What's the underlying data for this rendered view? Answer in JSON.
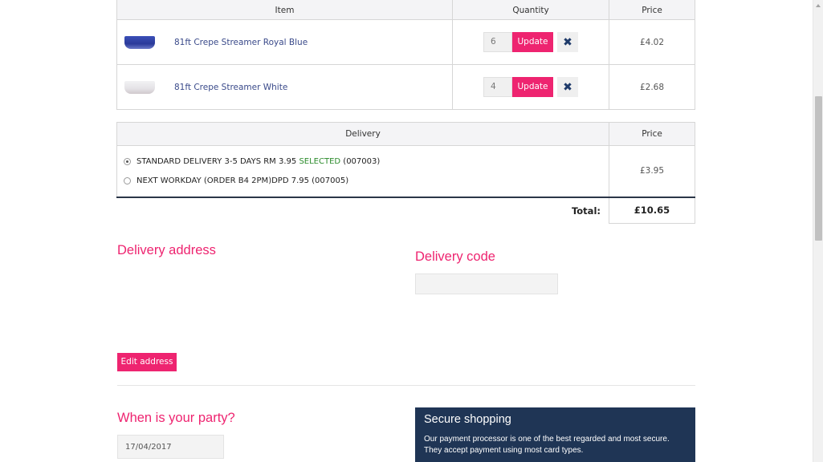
{
  "cart": {
    "headers": {
      "item": "Item",
      "quantity": "Quantity",
      "price": "Price"
    },
    "items": [
      {
        "name": "81ft Crepe Streamer Royal Blue",
        "qty": "6",
        "price": "£4.02",
        "update_label": "Update",
        "remove_symbol": "✖"
      },
      {
        "name": "81ft Crepe Streamer White",
        "qty": "4",
        "price": "£2.68",
        "update_label": "Update",
        "remove_symbol": "✖"
      }
    ]
  },
  "delivery": {
    "headers": {
      "delivery": "Delivery",
      "price": "Price"
    },
    "options": [
      {
        "label": "STANDARD DELIVERY 3-5 DAYS RM 3.95",
        "selected_tag": "SELECTED",
        "code": "(007003)",
        "checked": true
      },
      {
        "label": "NEXT WORKDAY (ORDER B4 2PM)DPD 7.95",
        "selected_tag": "",
        "code": "(007005)",
        "checked": false
      }
    ],
    "price": "£3.95",
    "total_label": "Total:",
    "total_value": "£10.65"
  },
  "address": {
    "title": "Delivery address",
    "edit_label": "Edit address"
  },
  "code": {
    "title": "Delivery code",
    "value": ""
  },
  "party": {
    "title": "When is your party?",
    "date": "17/04/2017"
  },
  "secure": {
    "title": "Secure shopping",
    "text": "Our payment processor is one of the best regarded and most secure. They accept payment using most card types."
  },
  "colors": {
    "accent": "#ee2470",
    "navy": "#1f3555",
    "selected": "#2a8a2a"
  }
}
